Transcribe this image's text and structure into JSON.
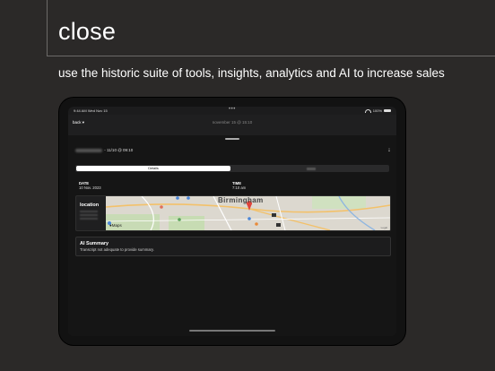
{
  "headline": "close",
  "tagline": "use the historic suite of tools, insights, analytics and AI to increase sales",
  "device": {
    "status": {
      "time": "9:44 AM",
      "date": "Wed Nov 15",
      "dots": "•••",
      "battery_pct": "100%"
    },
    "nav": {
      "back_label": "back",
      "title": "november 15 @ 15:10"
    },
    "detail": {
      "contact_suffix": "- 11/10 @ 09:10",
      "tabs": {
        "active": "Details"
      },
      "date_label": "DATE",
      "date_value": "10 Nov. 2023",
      "time_label": "TIME",
      "time_value": "7:10 am",
      "location_label": "location",
      "map": {
        "city": "Birmingham",
        "maps_label": "Maps",
        "legal": "Legal",
        "places": [
          "Birmingham Children's Hospital",
          "Edgbaston Park",
          "Birmingham Botanical Gardens",
          "Small Heath",
          "Bordesley",
          "Digbeth",
          "Ladywood",
          "Aston",
          "Bordesley Green",
          "Edgbaston"
        ]
      },
      "ai_title": "AI Summary",
      "ai_text": "Transcript not adequate to provide summary."
    }
  },
  "colors": {
    "background": "#2b2928",
    "accent_light": "#ffffff",
    "card": "#1f1f20"
  }
}
